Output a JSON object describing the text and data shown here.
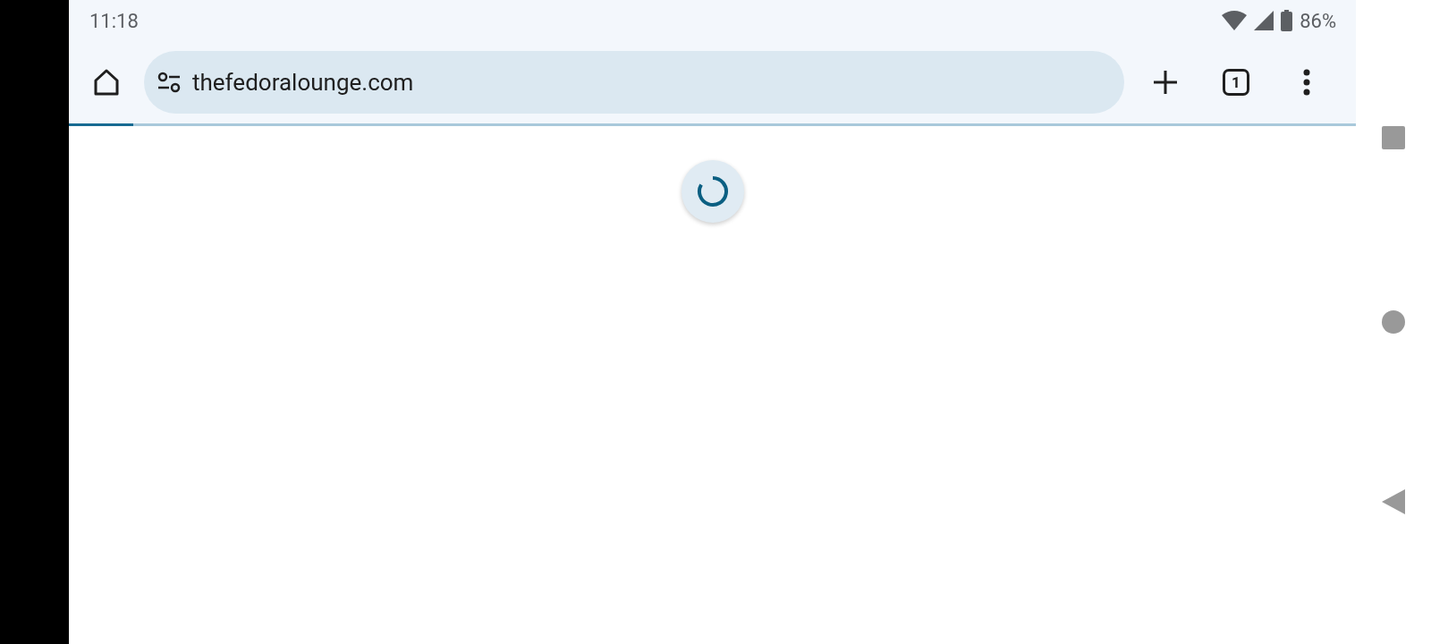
{
  "status_bar": {
    "time": "11:18",
    "battery": "86%"
  },
  "toolbar": {
    "url": "thefedoralounge.com",
    "tab_count": "1"
  },
  "page_load": {
    "level": 0.05
  }
}
